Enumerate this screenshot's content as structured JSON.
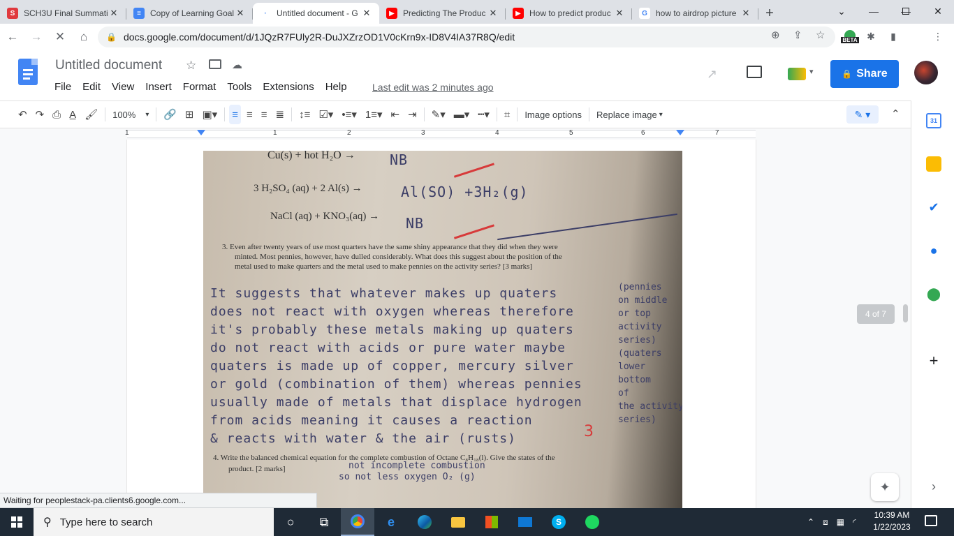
{
  "browser": {
    "tabs": [
      {
        "label": "SCH3U Final Summati",
        "favicon_color": "#e03a3e",
        "favicon_text": "S"
      },
      {
        "label": "Copy of Learning Goal",
        "favicon_color": "#4285f4",
        "favicon_text": "≡"
      },
      {
        "label": "Untitled document - G",
        "favicon_color": "#ffffff",
        "favicon_text": "·",
        "active": true
      },
      {
        "label": "Predicting The Produc",
        "favicon_color": "#ff0000",
        "favicon_text": "▶"
      },
      {
        "label": "How to predict produc",
        "favicon_color": "#ff0000",
        "favicon_text": "▶"
      },
      {
        "label": "how to airdrop picture",
        "favicon_color": "#ffffff",
        "favicon_text": "G"
      }
    ],
    "url": "docs.google.com/document/d/1JQzR7FUly2R-DuJXZrzOD1V0cKrn9x-ID8V4IA37R8Q/edit",
    "beta_label": "BETA",
    "status_text": "Waiting for peoplestack-pa.clients6.google.com..."
  },
  "doc": {
    "title": "Untitled document",
    "menu": [
      "File",
      "Edit",
      "View",
      "Insert",
      "Format",
      "Tools",
      "Extensions",
      "Help"
    ],
    "last_edit": "Last edit was 2 minutes ago",
    "share_label": "Share",
    "zoom": "100%",
    "image_options": "Image options",
    "replace_image": "Replace image",
    "ruler_numbers": [
      "1",
      "1",
      "2",
      "3",
      "4",
      "5",
      "6",
      "7"
    ],
    "page_counter": "4 of 7"
  },
  "photo": {
    "eq1": "Cu(s)  +  hot H₂O →",
    "eq1_answer": "NB",
    "eq2": "3 H₂SO₄ (aq)  + 2 Al(s) →",
    "eq2_answer": "Al(SO)  +3H₂(g)",
    "eq3": "NaCl (aq)  +   KNO₃(aq) →",
    "eq3_answer": "NB",
    "q3": "3.  Even after twenty years of use most quarters have the same shiny appearance that they did when they were",
    "q3_l2": "minted. Most pennies, however, have dulled considerably. What does this suggest about the position of the",
    "q3_l3": "metal used to make quarters and the metal used to make pennies on the activity series? [3 marks]",
    "answer_lines": [
      "It suggests  that  whatever makes up quaters",
      "does not react with oxygen  whereas  therefore",
      "it's probably these metals making up quaters",
      "do not react with acids or pure water maybe",
      "quaters is made up of copper, mercury silver",
      "or gold (combination of them) whereas pennies",
      "usually made of metals that displace hydrogen",
      "from acids meaning it causes a reaction",
      "& reacts with water & the air (rusts)"
    ],
    "side_notes": [
      "(pennies",
      "on middle",
      "or top",
      "activity",
      "series)",
      "(quaters",
      "lower",
      "bottom",
      "of",
      "the activity",
      "series)"
    ],
    "q4": "4.   Write the balanced chemical equation for the complete combustion of Octane C₈H₁₈(l). Give the states of the",
    "q4_l2": "product. [2 marks]",
    "q4_note1": "not incomplete combustion",
    "q4_note2": "so not less oxygen  O₂ (g)"
  },
  "taskbar": {
    "search_placeholder": "Type here to search",
    "time": "10:39 AM",
    "date": "1/22/2023"
  }
}
